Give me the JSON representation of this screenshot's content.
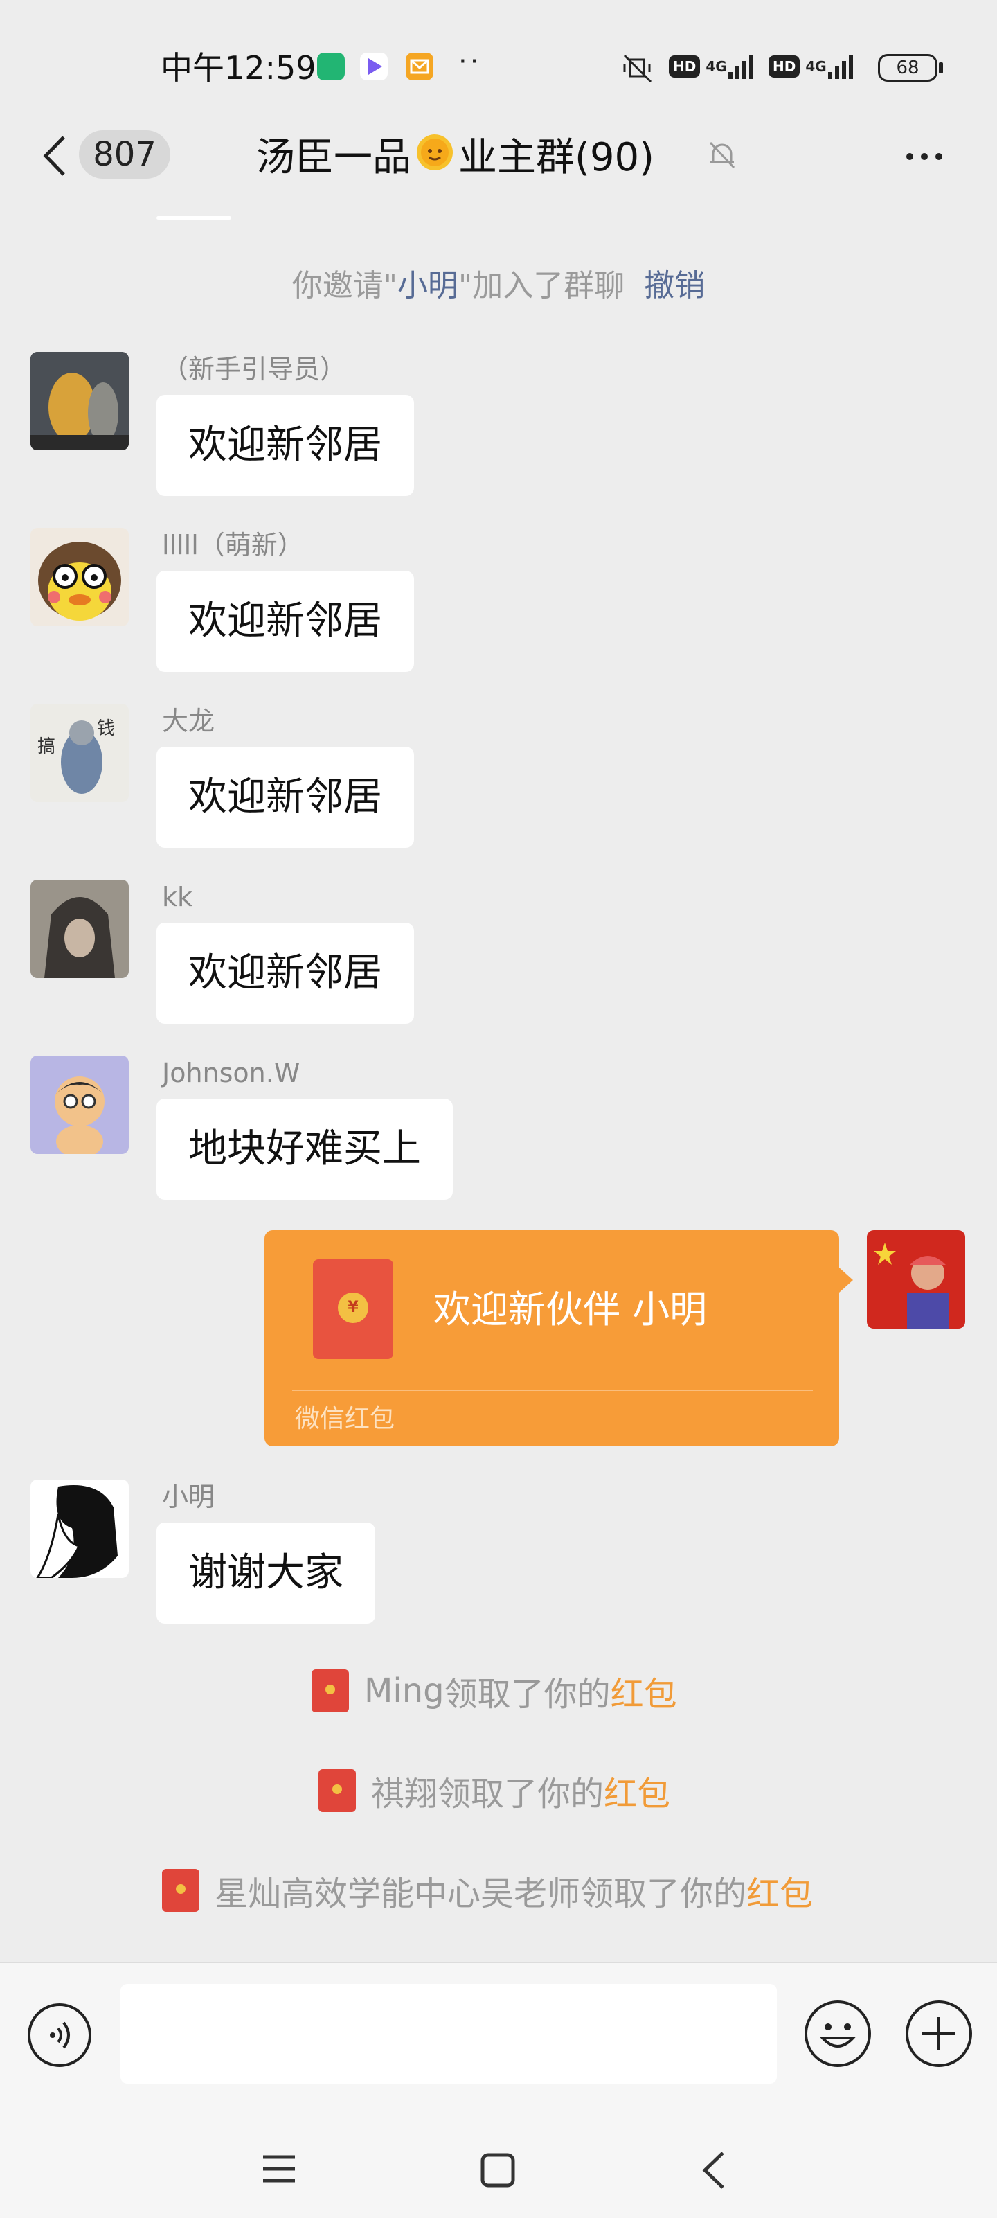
{
  "status_bar": {
    "time": "中午12:59",
    "network_labels": [
      "4G",
      "4G"
    ],
    "hd_label": "HD",
    "battery": "68"
  },
  "header": {
    "unread_count": "807",
    "title_part1": "汤臣一品",
    "title_part2": "业主群(90)"
  },
  "system_notice": {
    "prefix": "你邀请\"",
    "name": "小明",
    "suffix": "\"加入了群聊",
    "action": "撤销"
  },
  "messages": [
    {
      "sender": "（新手引导员）",
      "text": "欢迎新邻居"
    },
    {
      "sender": "lllll（萌新）",
      "text": "欢迎新邻居"
    },
    {
      "sender": "大龙",
      "text": "欢迎新邻居"
    },
    {
      "sender": "kk",
      "text": "欢迎新邻居"
    },
    {
      "sender": "Johnson.W",
      "text": "地块好难买上"
    }
  ],
  "red_packet": {
    "title": "欢迎新伙伴  小明",
    "label": "微信红包",
    "seal": "¥"
  },
  "reply": {
    "sender": "小明",
    "text": "谢谢大家"
  },
  "receipts": [
    {
      "name": "Ming",
      "action": "领取了你的",
      "link": "红包"
    },
    {
      "name": "祺翔",
      "action": "领取了你的",
      "link": "红包"
    },
    {
      "name": "星灿高效学能中心吴老师",
      "action": "领取了你的",
      "link": "红包"
    }
  ],
  "input": {
    "placeholder": ""
  },
  "colors": {
    "background": "#ededed",
    "link_blue": "#576b95",
    "red_packet": "#f79c38",
    "packet_link": "#f19b38"
  },
  "icons": [
    "back-arrow-icon",
    "mute-bell-icon",
    "more-icon",
    "voice-icon",
    "emoji-icon",
    "plus-icon",
    "nav-menu-icon",
    "nav-home-icon",
    "nav-back-icon"
  ]
}
